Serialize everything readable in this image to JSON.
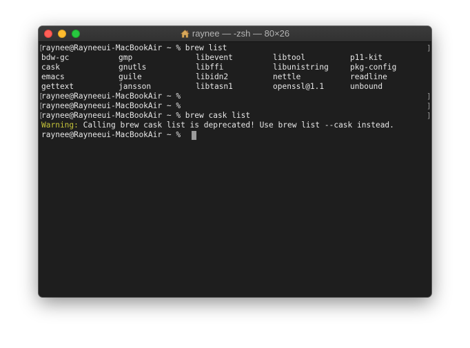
{
  "window": {
    "title": "raynee — -zsh — 80×26",
    "title_icon": "home-icon"
  },
  "terminal": {
    "prompt": "raynee@Rayneeui-MacBookAir ~ %",
    "line1_command": "raynee@Rayneeui-MacBookAir ~ % brew list",
    "brew_list": [
      [
        "bdw-gc",
        "gmp",
        "libevent",
        "libtool",
        "p11-kit"
      ],
      [
        "cask",
        "gnutls",
        "libffi",
        "libunistring",
        "pkg-config"
      ],
      [
        "emacs",
        "guile",
        "libidn2",
        "nettle",
        "readline"
      ],
      [
        "gettext",
        "jansson",
        "libtasn1",
        "openssl@1.1",
        "unbound"
      ]
    ],
    "line6": "raynee@Rayneeui-MacBookAir ~ %",
    "line7": "raynee@Rayneeui-MacBookAir ~ %",
    "line8_command": "raynee@Rayneeui-MacBookAir ~ % brew cask list",
    "warning_label": "Warning:",
    "warning_text": " Calling brew cask list is deprecated! Use brew list --cask instead.",
    "current_prompt": "raynee@Rayneeui-MacBookAir ~ %",
    "bracket_left": "[",
    "bracket_right": "]"
  },
  "colors": {
    "terminal_bg": "#1e1e1e",
    "text": "#e6e6e6",
    "warning": "#c6c43a",
    "close": "#fe5f57",
    "minimize": "#febc2e",
    "maximize": "#28c840"
  }
}
